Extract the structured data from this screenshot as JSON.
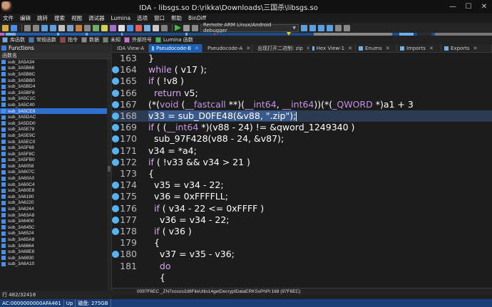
{
  "window": {
    "title": "IDA - libsgs.so D:\\rikka\\Downloads\\三国杀\\libsgs.so",
    "minimize": "—",
    "maximize": "☐",
    "close": "✕"
  },
  "menu": [
    "文件",
    "编辑",
    "跳转",
    "搜索",
    "视图",
    "调试器",
    "Lumina",
    "选项",
    "窗口",
    "帮助",
    "BinDiff"
  ],
  "toolbar": {
    "debugger_select": "Remote ARM Linux/Android debugger"
  },
  "legend": [
    {
      "label": "库函数",
      "color": "#6fb0e8"
    },
    {
      "label": "常规函数",
      "color": "#3a78c8"
    },
    {
      "label": "指令",
      "color": "#a04040"
    },
    {
      "label": "数据",
      "color": "#8c8c8c"
    },
    {
      "label": "未知",
      "color": "#6a8a6a"
    },
    {
      "label": "外部符号",
      "color": "#d070d0"
    },
    {
      "label": "Lumina 函数",
      "color": "#3cb850"
    }
  ],
  "functions_panel": {
    "title": "Functions",
    "column": "函数名",
    "items": [
      "sub_3A5A34",
      "sub_3A5B68",
      "sub_3A5B8C",
      "sub_3A5BB0",
      "sub_3A5BD4",
      "sub_3A5BF8",
      "sub_3A5C1C",
      "sub_3A5C40",
      "sub_3A5CE8",
      "sub_3A5DAC",
      "sub_3A5DD0",
      "sub_3A5E78",
      "sub_3A5E9C",
      "sub_3A5EC0",
      "sub_3A5F68",
      "sub_3A5F8C",
      "sub_3A5FB0",
      "sub_3A6058",
      "sub_3A607C",
      "sub_3A60A0",
      "sub_3A60C4",
      "sub_3A60E8",
      "sub_3A6190",
      "sub_3A6220",
      "sub_3A6244",
      "sub_3A63A8",
      "sub_3A6400",
      "sub_3A645C",
      "sub_3A6524",
      "sub_3A65A8",
      "sub_3A6664",
      "sub_3A68E8",
      "sub_3A6930",
      "sub_3A6A10"
    ],
    "selected_index": 8,
    "row_count": "行 482/32418"
  },
  "tabs": [
    {
      "label": "IDA View-A",
      "active": false,
      "color": "#3d7dd8"
    },
    {
      "label": "Pseudocode-B",
      "active": true,
      "color": "#7ec8ff"
    },
    {
      "label": "Pseudocode-A",
      "active": false,
      "color": "#7ec8ff"
    },
    {
      "label": "出现打开二进制: zip",
      "active": false,
      "color": "#999"
    },
    {
      "label": "Hex View-1",
      "active": false,
      "color": "#6fb0e8"
    },
    {
      "label": "Enums",
      "active": false,
      "color": "#6fb0e8"
    },
    {
      "label": "Imports",
      "active": false,
      "color": "#6fb0e8"
    },
    {
      "label": "Exports",
      "active": false,
      "color": "#6fb0e8"
    }
  ],
  "code_lines": [
    {
      "num": "163",
      "bp": false,
      "text": "}"
    },
    {
      "num": "164",
      "bp": true,
      "text": "while ( v17 );"
    },
    {
      "num": "165",
      "bp": true,
      "text": "if ( !v8 )"
    },
    {
      "num": "166",
      "bp": true,
      "text": "  return v5;"
    },
    {
      "num": "167",
      "bp": true,
      "text": "(*(void (__fastcall **)(__int64, __int64))(*(_QWORD *)a1 + 3"
    },
    {
      "num": "168",
      "bp": true,
      "text": "v33 = sub_D0FE48(&v88, \".zip\");"
    },
    {
      "num": "169",
      "bp": true,
      "text": "if ( (__int64 *)(v88 - 24) != &qword_1249340 )"
    },
    {
      "num": "170",
      "bp": true,
      "text": "  sub_97F428(v88 - 24, &v87);"
    },
    {
      "num": "171",
      "bp": true,
      "text": "v34 = *a4;"
    },
    {
      "num": "172",
      "bp": true,
      "text": "if ( !v33 && v34 > 21 )"
    },
    {
      "num": "173",
      "bp": false,
      "text": "{"
    },
    {
      "num": "174",
      "bp": true,
      "text": "  v35 = v34 - 22;"
    },
    {
      "num": "175",
      "bp": true,
      "text": "  v36 = 0xFFFFLL;"
    },
    {
      "num": "176",
      "bp": true,
      "text": "  if ( v34 - 22 <= 0xFFFF )"
    },
    {
      "num": "177",
      "bp": true,
      "text": "    v36 = v34 - 22;"
    },
    {
      "num": "178",
      "bp": true,
      "text": "  if ( v36 )"
    },
    {
      "num": "179",
      "bp": false,
      "text": "  {"
    },
    {
      "num": "180",
      "bp": true,
      "text": "    v37 = v35 - v36;"
    },
    {
      "num": "181",
      "bp": false,
      "text": "    do"
    },
    {
      "num": "",
      "bp": false,
      "text": "    {"
    }
  ],
  "highlight_line": 5,
  "code_status": "0097F6EC _ZN7cocos2d9FileUtils14getDecryptDataERKSsPhPl:168 (97F6EC)",
  "status": {
    "addr": "AC:0000000000AFA461",
    "mode": "Up",
    "disk": "磁盘: 275GB"
  }
}
